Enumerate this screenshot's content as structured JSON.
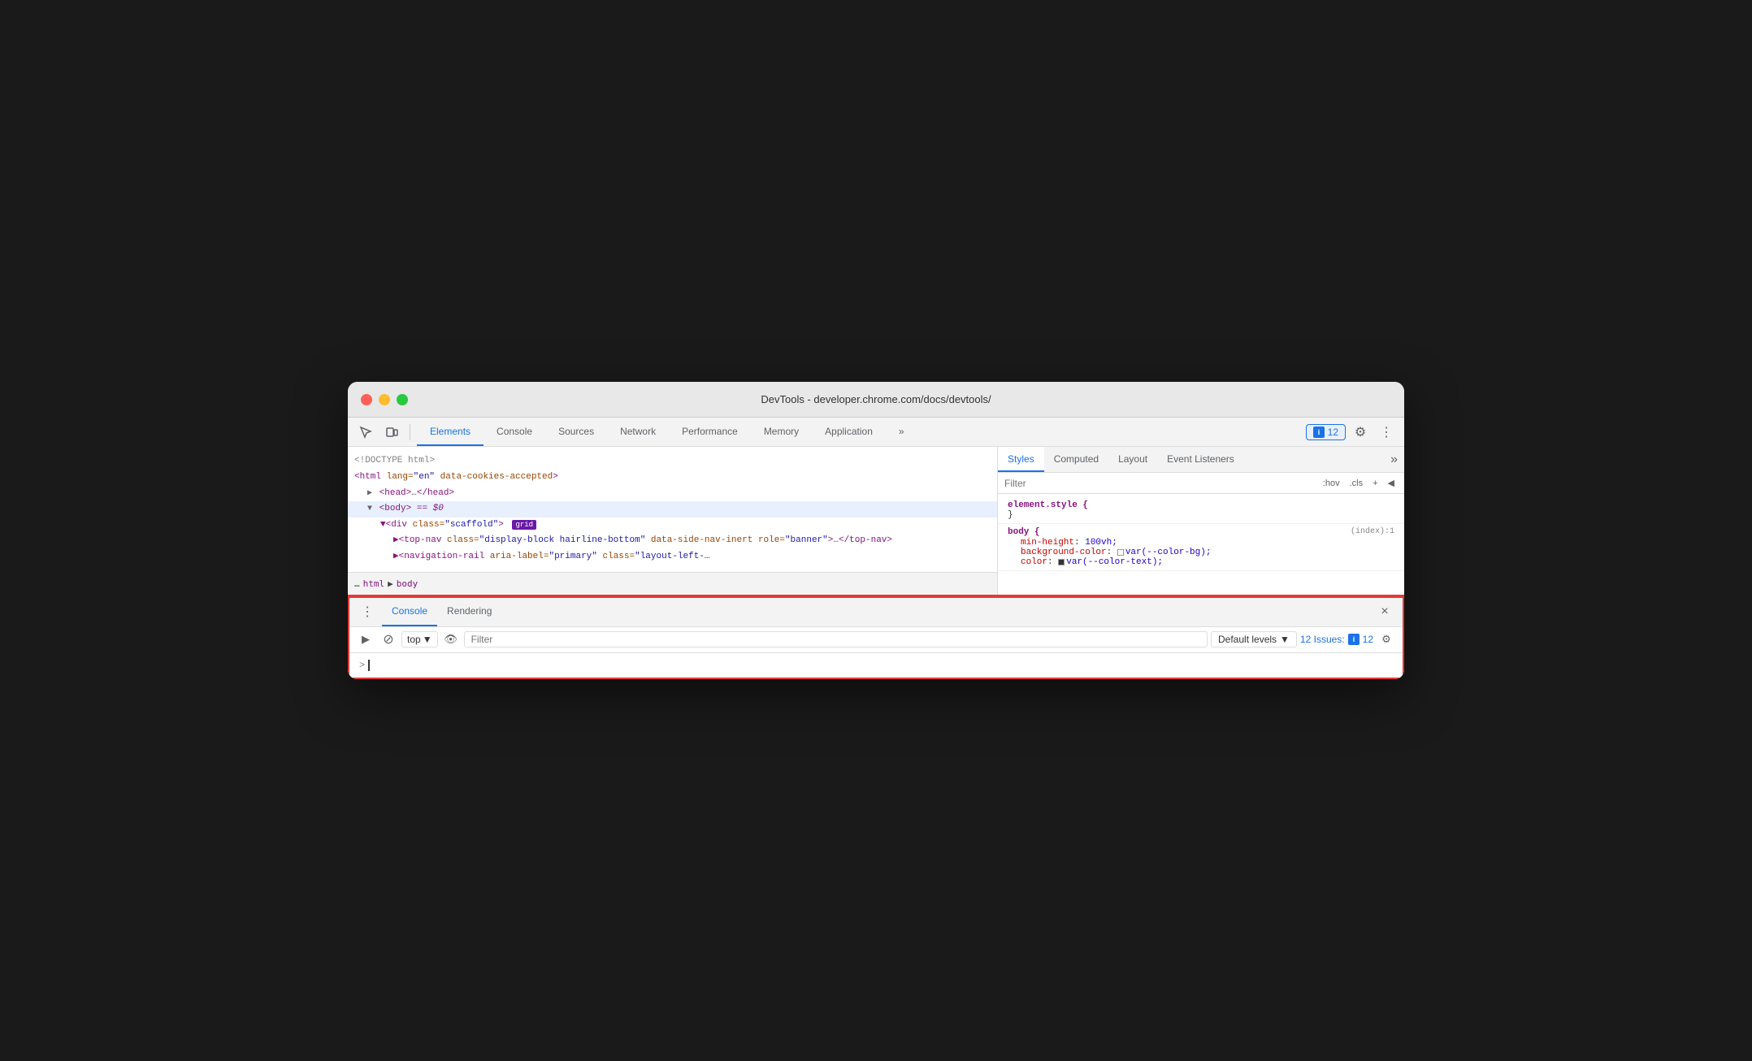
{
  "window": {
    "title": "DevTools - developer.chrome.com/docs/devtools/"
  },
  "toolbar": {
    "tabs": [
      {
        "id": "elements",
        "label": "Elements",
        "active": true
      },
      {
        "id": "console",
        "label": "Console",
        "active": false
      },
      {
        "id": "sources",
        "label": "Sources",
        "active": false
      },
      {
        "id": "network",
        "label": "Network",
        "active": false
      },
      {
        "id": "performance",
        "label": "Performance",
        "active": false
      },
      {
        "id": "memory",
        "label": "Memory",
        "active": false
      },
      {
        "id": "application",
        "label": "Application",
        "active": false
      }
    ],
    "issues_count": "12",
    "more_label": "»",
    "settings_label": "⚙",
    "more_options_label": "⋮"
  },
  "dom": {
    "lines": [
      {
        "text": "<!DOCTYPE html>",
        "indent": 0,
        "type": "comment"
      },
      {
        "text": "<html lang=\"en\" data-cookies-accepted>",
        "indent": 0,
        "type": "tag"
      },
      {
        "text": "▶<head>…</head>",
        "indent": 1,
        "type": "tag"
      },
      {
        "text": "▼<body> == $0",
        "indent": 1,
        "type": "tag",
        "selected": true
      },
      {
        "text": "<div class=\"scaffold\">",
        "indent": 2,
        "type": "tag",
        "badge": "grid"
      },
      {
        "text": "<top-nav class=\"display-block hairline-bottom\" data-side-nav-inert role=\"banner\">…</top-nav>",
        "indent": 3,
        "type": "tag"
      },
      {
        "text": "<navigation-rail aria-label=\"primary\" class=\"layout-left-…",
        "indent": 3,
        "type": "tag"
      }
    ],
    "breadcrumb": [
      "html",
      "body"
    ]
  },
  "styles_panel": {
    "tabs": [
      {
        "id": "styles",
        "label": "Styles",
        "active": true
      },
      {
        "id": "computed",
        "label": "Computed",
        "active": false
      },
      {
        "id": "layout",
        "label": "Layout",
        "active": false
      },
      {
        "id": "event-listeners",
        "label": "Event Listeners",
        "active": false
      }
    ],
    "filter_placeholder": "Filter",
    "hov_label": ":hov",
    "cls_label": ".cls",
    "plus_label": "+",
    "sections": [
      {
        "selector": "element.style {",
        "origin": "",
        "props": []
      },
      {
        "selector": "body {",
        "origin": "(index):1",
        "props": [
          {
            "name": "min-height",
            "value": "100vh;"
          },
          {
            "name": "background-color",
            "value": "var(--color-bg);",
            "swatch": true,
            "swatch_color": "#fff"
          },
          {
            "name": "color",
            "value": "var(--color-text);",
            "swatch": true,
            "swatch_color": "#333"
          }
        ]
      }
    ]
  },
  "console_drawer": {
    "tabs": [
      {
        "id": "console",
        "label": "Console",
        "active": true
      },
      {
        "id": "rendering",
        "label": "Rendering",
        "active": false
      }
    ],
    "top_label": "top",
    "filter_placeholder": "Filter",
    "default_levels_label": "Default levels",
    "issues_label": "12 Issues:",
    "issues_count": "12",
    "close_label": "×",
    "prompt": ">",
    "settings_label": "⚙"
  }
}
